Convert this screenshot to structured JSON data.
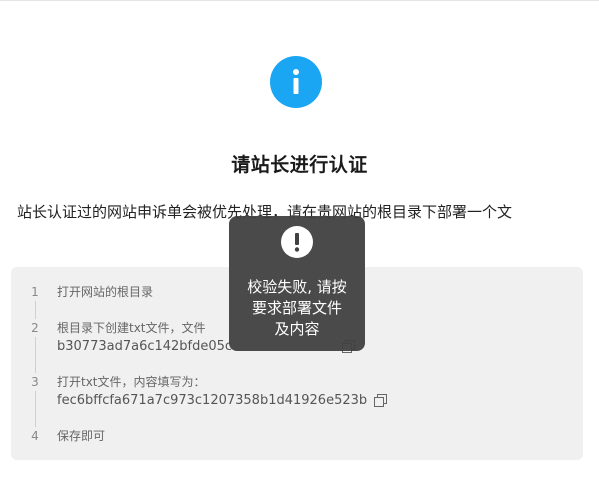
{
  "page": {
    "title": "请站长进行认证",
    "description": "站长认证过的网站申诉单会被优先处理，请在贵网站的根目录下部署一个文",
    "icons": {
      "badge": "info-icon",
      "copy": "copy-icon",
      "toast": "exclamation-icon"
    },
    "colors": {
      "accent": "#1aa6f3",
      "toast_bg": "#404040",
      "panel_bg": "#f0f0f0"
    }
  },
  "steps": [
    {
      "number": "1",
      "text": "打开网站的根目录"
    },
    {
      "number": "2",
      "text": "根目录下创建txt文件，文件",
      "value": "b30773ad7a6c142bfde05c"
    },
    {
      "number": "3",
      "text": "打开txt文件，内容填写为：",
      "value": "fec6bffcfa671a7c973c1207358b1d41926e523b"
    },
    {
      "number": "4",
      "text": "保存即可"
    }
  ],
  "toast": {
    "line1": "校验失败, 请按",
    "line2": "要求部署文件",
    "line3": "及内容"
  }
}
